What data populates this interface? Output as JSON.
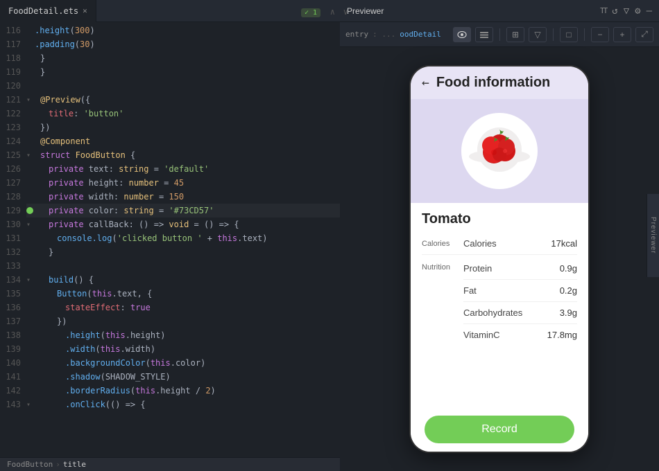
{
  "editor": {
    "tab": {
      "filename": "FoodDetail.ets",
      "check_badge": "✓ 1"
    },
    "lines": [
      {
        "num": 116,
        "indent": 2,
        "code": [
          {
            "t": "fn",
            "v": ".height"
          },
          {
            "t": "paren",
            "v": "("
          },
          {
            "t": "num",
            "v": "300"
          },
          {
            "t": "paren",
            "v": ")"
          }
        ]
      },
      {
        "num": 117,
        "indent": 2,
        "code": [
          {
            "t": "fn",
            "v": ".padding"
          },
          {
            "t": "paren",
            "v": "("
          },
          {
            "t": "num",
            "v": "30"
          },
          {
            "t": "paren",
            "v": ")"
          }
        ]
      },
      {
        "num": 118,
        "indent": 1,
        "code": [
          {
            "t": "plain",
            "v": "}"
          }
        ]
      },
      {
        "num": 119,
        "indent": 0,
        "code": [
          {
            "t": "plain",
            "v": "}"
          }
        ]
      },
      {
        "num": 120,
        "indent": 0,
        "code": []
      },
      {
        "num": 121,
        "indent": 0,
        "code": [
          {
            "t": "dec",
            "v": "@Preview"
          },
          {
            "t": "paren",
            "v": "({"
          }
        ]
      },
      {
        "num": 122,
        "indent": 2,
        "code": [
          {
            "t": "prop",
            "v": "title"
          },
          {
            "t": "plain",
            "v": ": "
          },
          {
            "t": "str",
            "v": "'button'"
          }
        ]
      },
      {
        "num": 123,
        "indent": 0,
        "code": [
          {
            "t": "plain",
            "v": "})"
          }
        ]
      },
      {
        "num": 124,
        "indent": 0,
        "code": [
          {
            "t": "dec",
            "v": "@Component"
          }
        ]
      },
      {
        "num": 125,
        "indent": 0,
        "code": [
          {
            "t": "kw",
            "v": "struct "
          },
          {
            "t": "type",
            "v": "FoodButton"
          },
          {
            "t": "plain",
            "v": " {"
          }
        ],
        "fold": true
      },
      {
        "num": 126,
        "indent": 2,
        "code": [
          {
            "t": "kw",
            "v": "private "
          },
          {
            "t": "plain",
            "v": "text: "
          },
          {
            "t": "type",
            "v": "string"
          },
          {
            "t": "plain",
            "v": " = "
          },
          {
            "t": "str",
            "v": "'default'"
          }
        ]
      },
      {
        "num": 127,
        "indent": 2,
        "code": [
          {
            "t": "kw",
            "v": "private "
          },
          {
            "t": "plain",
            "v": "height: "
          },
          {
            "t": "type",
            "v": "number"
          },
          {
            "t": "plain",
            "v": " = "
          },
          {
            "t": "num",
            "v": "45"
          }
        ]
      },
      {
        "num": 128,
        "indent": 2,
        "code": [
          {
            "t": "kw",
            "v": "private "
          },
          {
            "t": "plain",
            "v": "width: "
          },
          {
            "t": "type",
            "v": "number"
          },
          {
            "t": "plain",
            "v": " = "
          },
          {
            "t": "num",
            "v": "150"
          }
        ]
      },
      {
        "num": 129,
        "indent": 2,
        "code": [
          {
            "t": "kw",
            "v": "private "
          },
          {
            "t": "plain",
            "v": "color: "
          },
          {
            "t": "type",
            "v": "string"
          },
          {
            "t": "plain",
            "v": " = "
          },
          {
            "t": "str",
            "v": "'#73CD57'"
          }
        ],
        "dot": true
      },
      {
        "num": 130,
        "indent": 2,
        "code": [
          {
            "t": "kw",
            "v": "private "
          },
          {
            "t": "plain",
            "v": "callBack: () => "
          },
          {
            "t": "type",
            "v": "void"
          },
          {
            "t": "plain",
            "v": " = () => {"
          }
        ],
        "fold": true
      },
      {
        "num": 131,
        "indent": 3,
        "code": [
          {
            "t": "fn",
            "v": "console.log"
          },
          {
            "t": "paren",
            "v": "("
          },
          {
            "t": "str",
            "v": "'clicked button '"
          },
          {
            "t": "plain",
            "v": " + "
          },
          {
            "t": "kw",
            "v": "this"
          },
          {
            "t": "plain",
            "v": ".text"
          },
          {
            "t": "paren",
            "v": ")"
          }
        ]
      },
      {
        "num": 132,
        "indent": 2,
        "code": [
          {
            "t": "plain",
            "v": "}"
          }
        ]
      },
      {
        "num": 133,
        "indent": 0,
        "code": []
      },
      {
        "num": 134,
        "indent": 2,
        "code": [
          {
            "t": "fn",
            "v": "build"
          },
          {
            "t": "paren",
            "v": "()"
          },
          {
            "t": "plain",
            "v": " {"
          }
        ],
        "fold": true
      },
      {
        "num": 135,
        "indent": 3,
        "code": [
          {
            "t": "fn",
            "v": "Button"
          },
          {
            "t": "paren",
            "v": "("
          },
          {
            "t": "kw",
            "v": "this"
          },
          {
            "t": "plain",
            "v": ".text, {"
          }
        ]
      },
      {
        "num": 136,
        "indent": 4,
        "code": [
          {
            "t": "prop",
            "v": "stateEffect"
          },
          {
            "t": "plain",
            "v": ": "
          },
          {
            "t": "kw",
            "v": "true"
          }
        ]
      },
      {
        "num": 137,
        "indent": 3,
        "code": [
          {
            "t": "plain",
            "v": "})"
          }
        ]
      },
      {
        "num": 138,
        "indent": 4,
        "code": [
          {
            "t": "fn",
            "v": ".height"
          },
          {
            "t": "paren",
            "v": "("
          },
          {
            "t": "kw",
            "v": "this"
          },
          {
            "t": "plain",
            "v": ".height"
          },
          {
            "t": "paren",
            "v": ")"
          }
        ]
      },
      {
        "num": 139,
        "indent": 4,
        "code": [
          {
            "t": "fn",
            "v": ".width"
          },
          {
            "t": "paren",
            "v": "("
          },
          {
            "t": "kw",
            "v": "this"
          },
          {
            "t": "plain",
            "v": ".width"
          },
          {
            "t": "paren",
            "v": ")"
          }
        ]
      },
      {
        "num": 140,
        "indent": 4,
        "code": [
          {
            "t": "fn",
            "v": ".backgroundColor"
          },
          {
            "t": "paren",
            "v": "("
          },
          {
            "t": "kw",
            "v": "this"
          },
          {
            "t": "plain",
            "v": ".color"
          },
          {
            "t": "paren",
            "v": ")"
          }
        ]
      },
      {
        "num": 141,
        "indent": 4,
        "code": [
          {
            "t": "fn",
            "v": ".shadow"
          },
          {
            "t": "paren",
            "v": "("
          },
          {
            "t": "plain",
            "v": "SHADOW_STYLE"
          },
          {
            "t": "paren",
            "v": ")"
          }
        ]
      },
      {
        "num": 142,
        "indent": 4,
        "code": [
          {
            "t": "fn",
            "v": ".borderRadius"
          },
          {
            "t": "paren",
            "v": "("
          },
          {
            "t": "kw",
            "v": "this"
          },
          {
            "t": "plain",
            "v": ".height / "
          },
          {
            "t": "num",
            "v": "2"
          },
          {
            "t": "paren",
            "v": ")"
          }
        ]
      },
      {
        "num": 143,
        "indent": 4,
        "code": [
          {
            "t": "fn",
            "v": ".onClick"
          },
          {
            "t": "paren",
            "v": "(("
          },
          {
            "t": "plain",
            "v": ") => {"
          }
        ],
        "fold": true
      }
    ],
    "breadcrumb": {
      "component": "FoodButton",
      "sep": "›",
      "member": "title"
    }
  },
  "previewer": {
    "title": "Previewer",
    "titlebar_icons": [
      "↑↑",
      "↺",
      "▽",
      "⚙",
      "—"
    ],
    "entry_label": "entry",
    "entry_sep": " : ...",
    "entry_name": "oodDetail",
    "toolbar_buttons": [
      "👁",
      "⊞",
      "▦",
      "▽",
      "□",
      "−",
      "+",
      "⤢"
    ],
    "phone": {
      "header_title": "Food information",
      "food_name": "Tomato",
      "sections": [
        {
          "section_label": "Calories",
          "rows": [
            {
              "label": "Calories",
              "value": "17kcal"
            }
          ]
        },
        {
          "section_label": "Nutrition",
          "rows": [
            {
              "label": "Protein",
              "value": "0.9g"
            },
            {
              "label": "Fat",
              "value": "0.2g"
            },
            {
              "label": "Carbohydrates",
              "value": "3.9g"
            },
            {
              "label": "VitaminC",
              "value": "17.8mg"
            }
          ]
        }
      ],
      "record_button": "Record"
    }
  }
}
